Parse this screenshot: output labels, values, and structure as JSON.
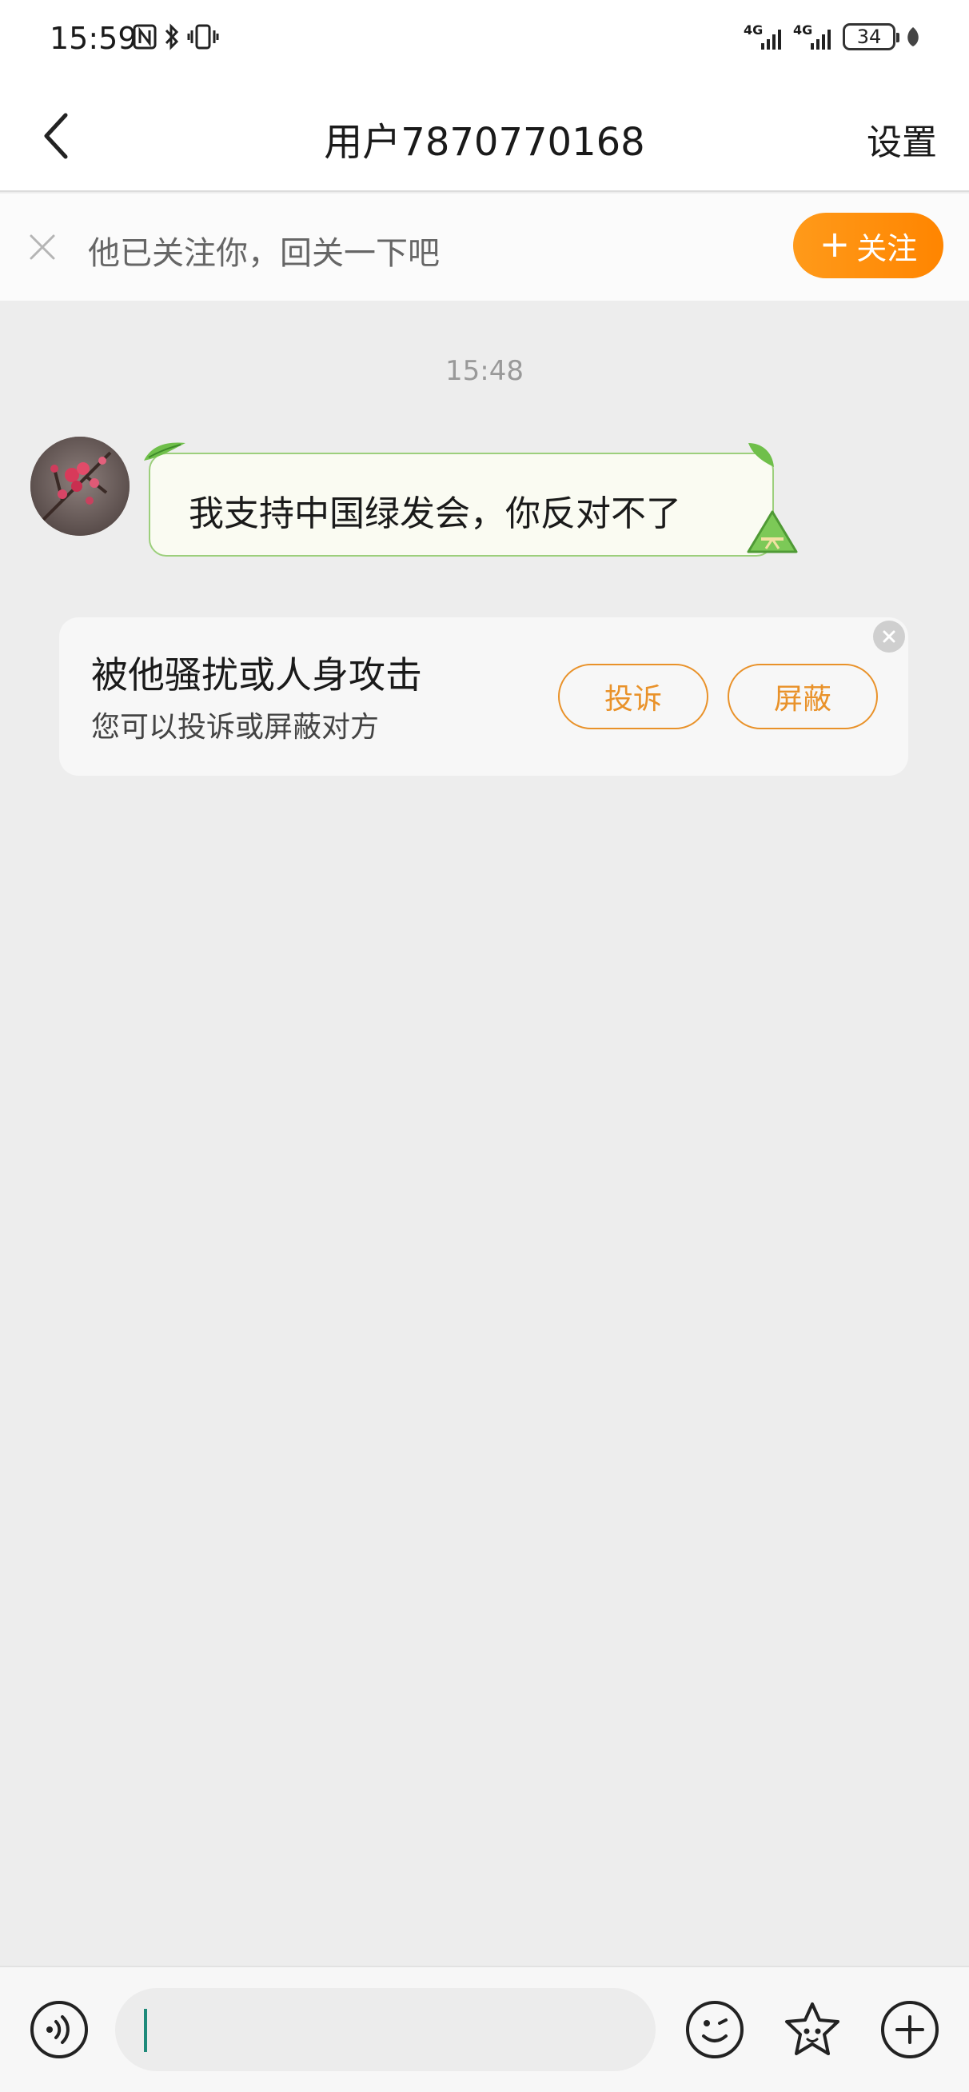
{
  "status_bar": {
    "time": "15:59",
    "network_1": "4G",
    "network_2": "4G",
    "battery": "34"
  },
  "nav": {
    "title": "用户7870770168",
    "settings_label": "设置"
  },
  "follow_banner": {
    "text": "他已关注你，回关一下吧",
    "button_label": "关注",
    "button_icon": "+"
  },
  "chat": {
    "timestamp": "15:48",
    "messages": [
      {
        "sender": "other",
        "text": "我支持中国绿发会，你反对不了"
      }
    ]
  },
  "harassment_card": {
    "title": "被他骚扰或人身攻击",
    "subtitle": "您可以投诉或屏蔽对方",
    "report_label": "投诉",
    "block_label": "屏蔽"
  },
  "input_bar": {
    "value": "",
    "icons": [
      "voice-icon",
      "emoji-icon",
      "sticker-icon",
      "plus-icon"
    ]
  },
  "colors": {
    "accent_orange": "#ff8a00",
    "bubble_border": "#9ccf7c",
    "background": "#ededed"
  }
}
